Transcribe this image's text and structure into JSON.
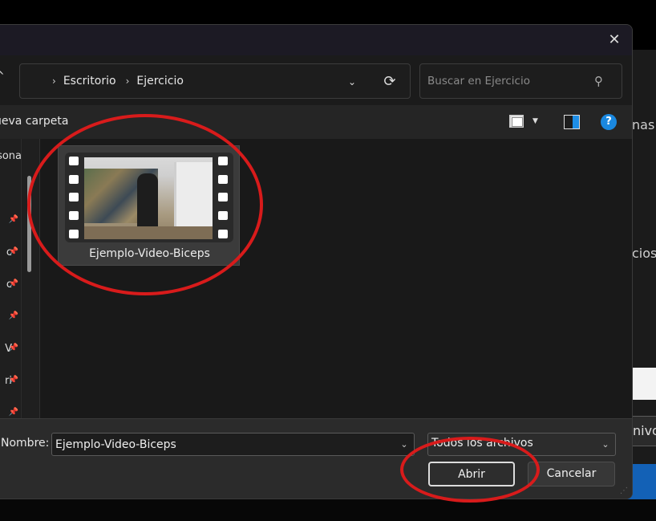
{
  "background": {
    "fragments": [
      "nas",
      "cios",
      "nivo"
    ]
  },
  "dialog": {
    "close_icon": "✕",
    "address": {
      "breadcrumbs": [
        "Escritorio",
        "Ejercicio"
      ]
    },
    "search": {
      "placeholder": "Buscar en Ejercicio"
    },
    "command_bar": {
      "new_folder_label": "ueva carpeta",
      "help_label": "?"
    },
    "navigation_pane": {
      "items": [
        {
          "label": "sona",
          "pinned": false
        },
        {
          "label": "",
          "pinned": true
        },
        {
          "label": "c",
          "pinned": true
        },
        {
          "label": "c",
          "pinned": true
        },
        {
          "label": "",
          "pinned": true
        },
        {
          "label": "V",
          "pinned": true
        },
        {
          "label": "ri",
          "pinned": true
        },
        {
          "label": "",
          "pinned": true
        }
      ]
    },
    "files": [
      {
        "name": "Ejemplo-Video-Biceps",
        "type": "video",
        "selected": true
      }
    ],
    "footer": {
      "name_label": "Nombre:",
      "file_name_value": "Ejemplo-Video-Biceps",
      "file_type_value": "Todos los archivos",
      "open_label": "Abrir",
      "cancel_label": "Cancelar"
    }
  },
  "annotations": {
    "highlight_color": "#d81b1b",
    "targets": [
      "file-tile",
      "open-button"
    ]
  }
}
